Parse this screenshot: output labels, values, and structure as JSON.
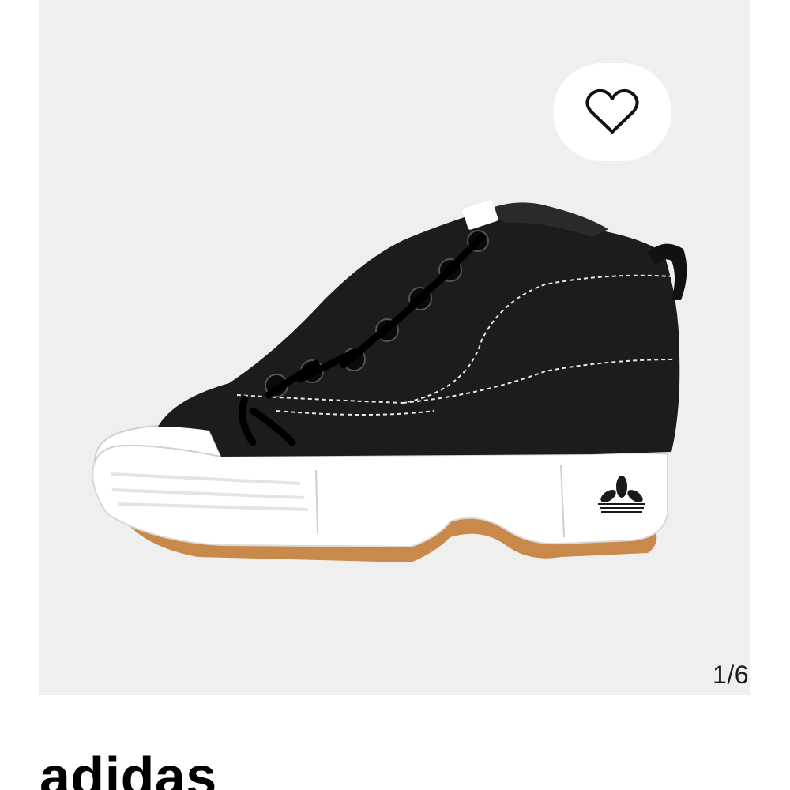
{
  "gallery": {
    "counter": "1/6",
    "favorite_icon": "heart-outline-icon",
    "image": "product-photo"
  },
  "product": {
    "brand": "adidas"
  },
  "colors": {
    "gallery_background": "#f0efef",
    "accent": "#000000"
  }
}
